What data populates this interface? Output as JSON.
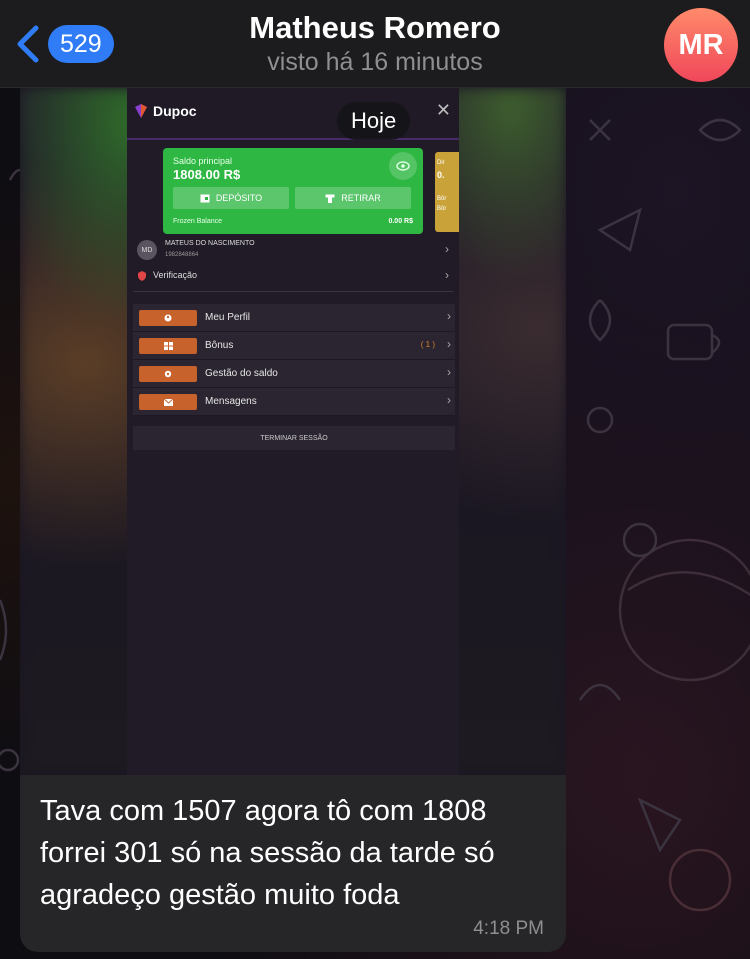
{
  "header": {
    "back_badge": "529",
    "contact_name": "Matheus Romero",
    "status": "visto há 16 minutos",
    "avatar_initials": "MR",
    "avatar_colors": [
      "#ff8a6a",
      "#f0475a"
    ]
  },
  "date_pill": "Hoje",
  "photo": {
    "app_name": "Dupoc",
    "balance_label": "Saldo principal",
    "balance_value": "1808.00 R$",
    "deposit_label": "DEPÓSITO",
    "withdraw_label": "RETIRAR",
    "frozen_label": "Frozen Balance",
    "frozen_value": "0.00 R$",
    "side_card_lines": [
      "Dir",
      "0.",
      "Bôr",
      "Bôr"
    ],
    "user_initials": "MD",
    "user_name": "MATEUS DO NASCIMENTO",
    "user_id": "1982848864",
    "verification_label": "Verificação",
    "menu": [
      {
        "label": "Meu Perfil",
        "icon": "user-icon",
        "extra": ""
      },
      {
        "label": "Bônus",
        "icon": "gift-icon",
        "extra": "( 1 )"
      },
      {
        "label": "Gestão do saldo",
        "icon": "gear-icon",
        "extra": ""
      },
      {
        "label": "Mensagens",
        "icon": "envelope-icon",
        "extra": ""
      }
    ],
    "logout_label": "TERMINAR SESSÃO",
    "colors": {
      "balance_card": "#2fb744",
      "menu_pill": "#c8622d",
      "side_card": "#c9a23a"
    }
  },
  "message": {
    "text": "Tava com 1507  agora tô com 1808 forrei 301 só na sessão da tarde só agradeço gestão muito foda",
    "time": "4:18 PM"
  },
  "colors": {
    "badge": "#2f7cf6",
    "bubble": "#262628",
    "header": "#1c1c1e"
  }
}
